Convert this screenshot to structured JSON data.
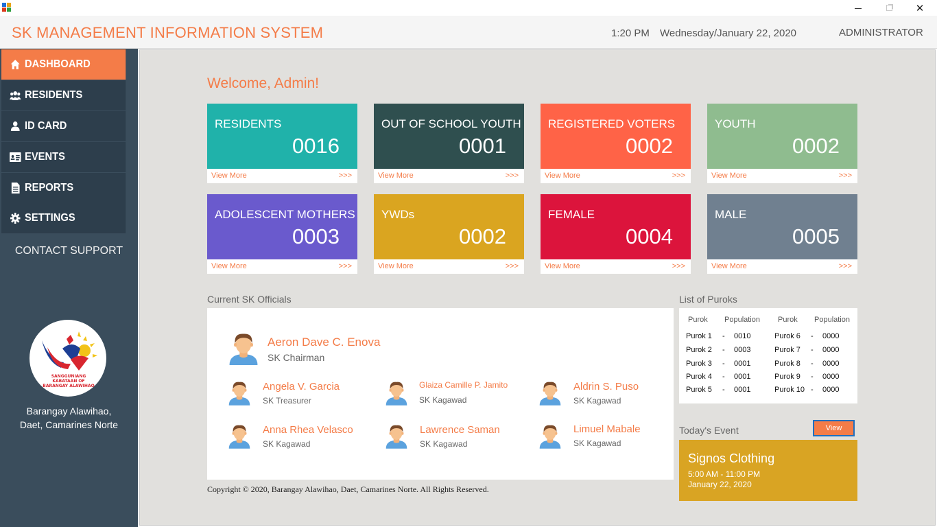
{
  "window": {
    "minimize_glyph": "",
    "close_glyph": "✕"
  },
  "header": {
    "title": "SK MANAGEMENT INFORMATION SYSTEM",
    "time": "1:20 PM",
    "date": "Wednesday/January 22, 2020",
    "user": "ADMINISTRATOR"
  },
  "sidebar": {
    "items": [
      {
        "label": "DASHBOARD",
        "icon": "home-icon"
      },
      {
        "label": "RESIDENTS",
        "icon": "users-icon"
      },
      {
        "label": "ID CARD",
        "icon": "user-icon"
      },
      {
        "label": "EVENTS",
        "icon": "id-badge-icon"
      },
      {
        "label": "REPORTS",
        "icon": "document-icon"
      },
      {
        "label": "SETTINGS",
        "icon": "gear-icon"
      }
    ],
    "contact": "CONTACT SUPPORT",
    "logo_text": [
      "SANGGUNIANG",
      "KABATAAN OF",
      "BARANGAY ALAWIHAO"
    ],
    "location_line1": "Barangay Alawihao,",
    "location_line2": "Daet, Camarines Norte"
  },
  "main": {
    "welcome": "Welcome, Admin!",
    "view_more": "View More",
    "arrows": ">>>",
    "cards": [
      {
        "title": "RESIDENTS",
        "value": "0016",
        "color": "#20b2aa"
      },
      {
        "title": "OUT OF SCHOOL YOUTH",
        "value": "0001",
        "color": "#2f4f4f"
      },
      {
        "title": "REGISTERED VOTERS",
        "value": "0002",
        "color": "#ff6347"
      },
      {
        "title": "YOUTH",
        "value": "0002",
        "color": "#8fbc8f"
      },
      {
        "title": "ADOLESCENT MOTHERS",
        "value": "0003",
        "color": "#6a5acd"
      },
      {
        "title": "YWDs",
        "value": "0002",
        "color": "#daa520"
      },
      {
        "title": "FEMALE",
        "value": "0004",
        "color": "#dc143c"
      },
      {
        "title": "MALE",
        "value": "0005",
        "color": "#708090"
      }
    ],
    "officials_label": "Current SK Officials",
    "officials": [
      {
        "name": "Aeron Dave C. Enova",
        "role": "SK Chairman"
      },
      {
        "name": "Angela V. Garcia",
        "role": "SK Treasurer"
      },
      {
        "name": "Glaiza Camille P.  Jamito",
        "role": "SK Kagawad"
      },
      {
        "name": "Aldrin S. Puso",
        "role": "SK Kagawad"
      },
      {
        "name": "Anna Rhea Velasco",
        "role": "SK Kagawad"
      },
      {
        "name": "Lawrence Saman",
        "role": "SK Kagawad"
      },
      {
        "name": "Limuel Mabale",
        "role": "SK Kagawad"
      }
    ],
    "puroks_label": "List of Puroks",
    "puroks_headers": {
      "purok": "Purok",
      "population": "Population"
    },
    "puroks_dash": "-",
    "puroks": [
      {
        "name": "Purok 1",
        "population": "0010"
      },
      {
        "name": "Purok 2",
        "population": "0003"
      },
      {
        "name": "Purok 3",
        "population": "0001"
      },
      {
        "name": "Purok 4",
        "population": "0001"
      },
      {
        "name": "Purok 5",
        "population": "0001"
      },
      {
        "name": "Purok 6",
        "population": "0000"
      },
      {
        "name": "Purok 7",
        "population": "0000"
      },
      {
        "name": "Purok 8",
        "population": "0000"
      },
      {
        "name": "Purok 9",
        "population": "0000"
      },
      {
        "name": "Purok 10",
        "population": "0000"
      }
    ],
    "event_label": "Today's Event",
    "event_view": "View",
    "event": {
      "name": "Signos Clothing",
      "time": "5:00 AM - 11:00 PM",
      "date": "January 22, 2020"
    },
    "copyright": "Copyright © 2020, Barangay Alawihao, Daet, Camarines Norte. All Rights Reserved."
  }
}
